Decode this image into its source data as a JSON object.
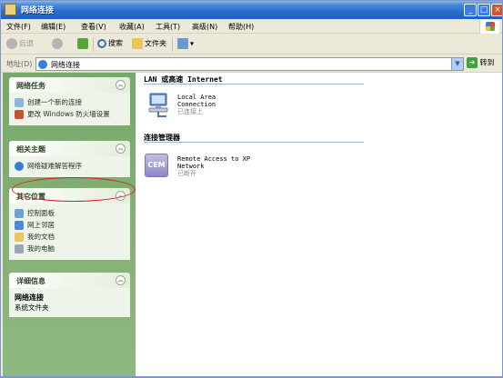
{
  "window": {
    "title": "网络连接"
  },
  "menu": [
    "文件(F)",
    "编辑(E)",
    "查看(V)",
    "收藏(A)",
    "工具(T)",
    "高级(N)",
    "帮助(H)"
  ],
  "toolbar": {
    "back": "后退",
    "search": "搜索",
    "folders": "文件夹"
  },
  "address": {
    "label": "地址(D)",
    "value": "网络连接",
    "go": "转到"
  },
  "panels": {
    "tasks": {
      "title": "网络任务",
      "items": [
        "创建一个新的连接",
        "更改 Windows 防火墙设置"
      ]
    },
    "related": {
      "title": "相关主题",
      "items": [
        "网络疑难解答程序"
      ]
    },
    "other": {
      "title": "其它位置",
      "items": [
        "控制面板",
        "网上邻居",
        "我的文档",
        "我的电脑"
      ]
    },
    "details": {
      "title": "详细信息",
      "name": "网络连接",
      "type": "系统文件夹"
    }
  },
  "content": {
    "group1": "LAN 或高速 Internet",
    "lan": {
      "name1": "Local Area",
      "name2": "Connection",
      "status": "已连接上"
    },
    "group2": "连接管理器",
    "vpn": {
      "name1": "Remote Access to XP",
      "name2": "Network",
      "status": "已断开",
      "icon_text": "CEM"
    }
  }
}
